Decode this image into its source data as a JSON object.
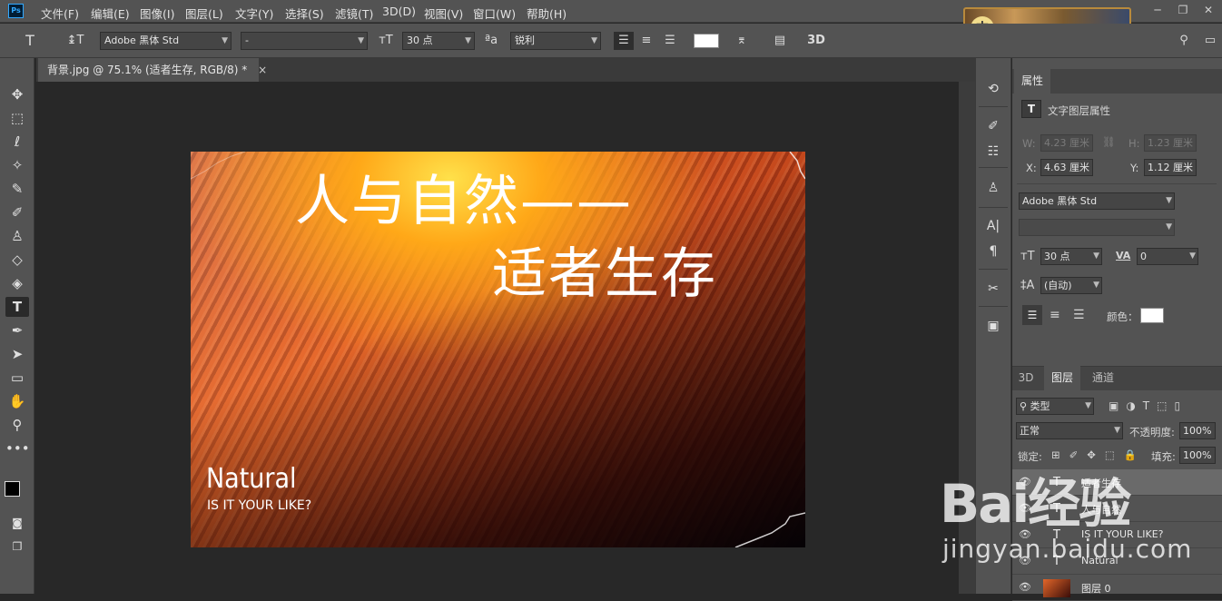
{
  "app": {
    "logo": "Ps"
  },
  "menu": [
    "文件(F)",
    "编辑(E)",
    "图像(I)",
    "图层(L)",
    "文字(Y)",
    "选择(S)",
    "滤镜(T)",
    "3D(D)",
    "视图(V)",
    "窗口(W)",
    "帮助(H)"
  ],
  "banner_glyph": "中",
  "window_controls": {
    "minimize": "─",
    "restore": "❐",
    "close": "✕"
  },
  "options": {
    "tool_glyph": "T",
    "orient_glyph": "↨T",
    "font_family": "Adobe 黑体 Std",
    "font_style": "-",
    "size_glyph": "тT",
    "font_size": "30 点",
    "aa_glyph": "ªa",
    "antialias": "锐利",
    "warp_glyph": "⌆",
    "panel_glyph": "▤",
    "threed": "3D"
  },
  "document_tab": {
    "title": "背景.jpg @ 75.1% (适者生存, RGB/8) *",
    "close": "×"
  },
  "canvas": {
    "title_line1": "人与自然——",
    "title_line2": "适者生存",
    "natural": "Natural",
    "subtitle": "IS IT YOUR LIKE?"
  },
  "properties": {
    "tab": "属性",
    "header": "文字图层属性",
    "type_glyph": "T",
    "w_label": "W:",
    "w_value": "4.23 厘米",
    "link_glyph": "⛓",
    "h_label": "H:",
    "h_value": "1.23 厘米",
    "x_label": "X:",
    "x_value": "4.63 厘米",
    "y_label": "Y:",
    "y_value": "1.12 厘米",
    "font_family": "Adobe 黑体 Std",
    "font_style": "",
    "size_glyph": "тT",
    "font_size": "30 点",
    "tracking_glyph": "VA",
    "tracking": "0",
    "leading_glyph": "‡A",
    "leading": "(自动)",
    "color_label": "颜色："
  },
  "layers_panel": {
    "tabs": [
      "3D",
      "图层",
      "通道"
    ],
    "filter_kind": "类型",
    "blend_mode": "正常",
    "opacity_label": "不透明度:",
    "opacity": "100%",
    "lock_label": "锁定:",
    "fill_label": "填充:",
    "fill": "100%",
    "layers": [
      {
        "name": "适者生存",
        "type": "T",
        "selected": true
      },
      {
        "name": "人与自然",
        "type": "T",
        "selected": false
      },
      {
        "name": "IS IT YOUR LIKE?",
        "type": "T",
        "selected": false
      },
      {
        "name": "Natural",
        "type": "T",
        "selected": false
      },
      {
        "name": "图层 0",
        "type": "",
        "selected": false
      }
    ]
  },
  "watermark": {
    "brand": "Bai经验",
    "url": "jingyan.baidu.com"
  },
  "colors": {
    "ui_bg": "#535353",
    "canvas_bg": "#282828",
    "text_color": "#ffffff"
  }
}
